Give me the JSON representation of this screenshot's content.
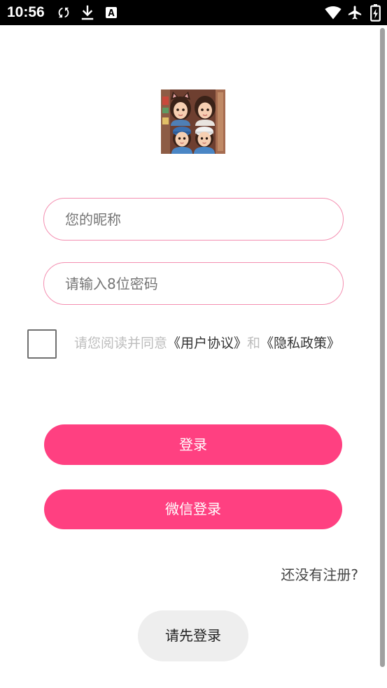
{
  "status_bar": {
    "time": "10:56",
    "left_icons": [
      "sync-icon",
      "download-icon",
      "a-box-icon"
    ],
    "right_icons": [
      "wifi-icon",
      "airplane-mode-icon",
      "battery-charging-icon"
    ]
  },
  "logo": {
    "icon": "app-logo"
  },
  "form": {
    "nickname": {
      "placeholder": "您的昵称",
      "value": ""
    },
    "password": {
      "placeholder": "请输入8位密码",
      "value": ""
    }
  },
  "agreement": {
    "checked": false,
    "prefix": "请您阅读并同意",
    "user_agreement": "《用户协议》",
    "conjunction": "和",
    "privacy_policy": "《隐私政策》"
  },
  "buttons": {
    "login": "登录",
    "wechat_login": "微信登录"
  },
  "register_link": "还没有注册?",
  "toast": {
    "message": "请先登录"
  },
  "colors": {
    "accent": "#FF4081",
    "status_bg": "#000000",
    "input_border": "#F48FB1",
    "muted_text": "#BDBDBD",
    "link_text": "#333333",
    "placeholder_text": "#757575",
    "toast_bg": "#EEEEEE",
    "toast_text": "#222222",
    "scrollbar": "#A0A0A0"
  }
}
